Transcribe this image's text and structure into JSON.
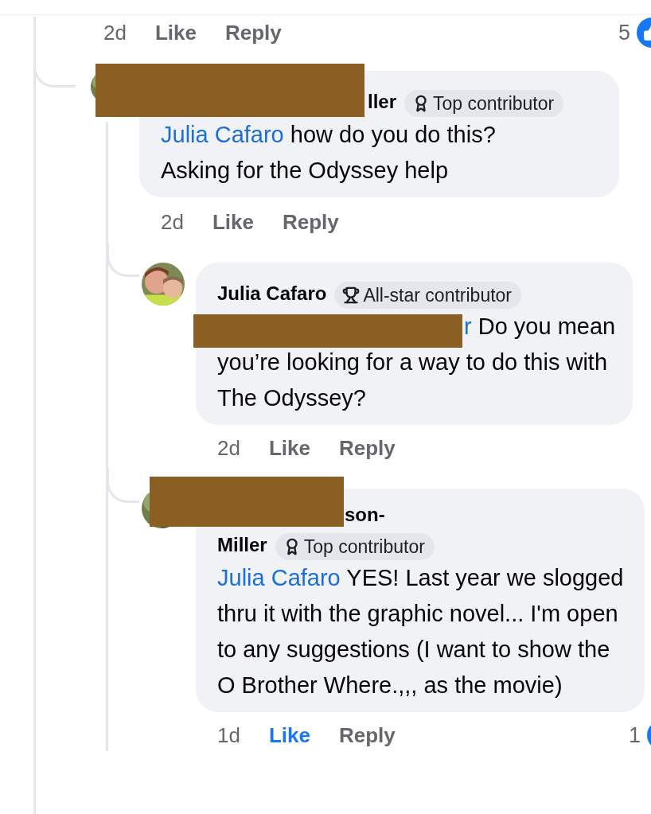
{
  "top_actions": {
    "time": "2d",
    "like": {
      "label": "Like",
      "liked": false
    },
    "reply": "Reply",
    "reaction_count": "5"
  },
  "comments": [
    {
      "author": "ller",
      "author_redacted": true,
      "badge": {
        "kind": "top",
        "label": "Top contributor"
      },
      "body": [
        {
          "kind": "mention",
          "text": "Julia Cafaro"
        },
        {
          "kind": "text",
          "text": " how do you do this? Asking for the Odyssey help"
        }
      ],
      "time": "2d",
      "like": {
        "label": "Like",
        "liked": false
      },
      "reply": "Reply",
      "replies": [
        {
          "author": "Julia Cafaro",
          "badge": {
            "kind": "allstar",
            "label": "All-star contributor"
          },
          "body": [
            {
              "kind": "mention",
              "text": "r",
              "redacted": true
            },
            {
              "kind": "text",
              "text": " Do you mean you’re looking for a way to do this with The Odyssey?"
            }
          ],
          "time": "2d",
          "like": {
            "label": "Like",
            "liked": false
          },
          "reply": "Reply"
        },
        {
          "author": "son-Miller",
          "author_redacted": true,
          "badge": {
            "kind": "top",
            "label": "Top contributor"
          },
          "body": [
            {
              "kind": "mention",
              "text": "Julia Cafaro"
            },
            {
              "kind": "text",
              "text": " YES! Last year we slogged thru it with the graphic novel... I'm open to any suggestions (I want to show the O Brother Where.,,, as the movie)"
            }
          ],
          "time": "1d",
          "like": {
            "label": "Like",
            "liked": true
          },
          "reply": "Reply",
          "reaction_count": "1"
        }
      ]
    }
  ]
}
